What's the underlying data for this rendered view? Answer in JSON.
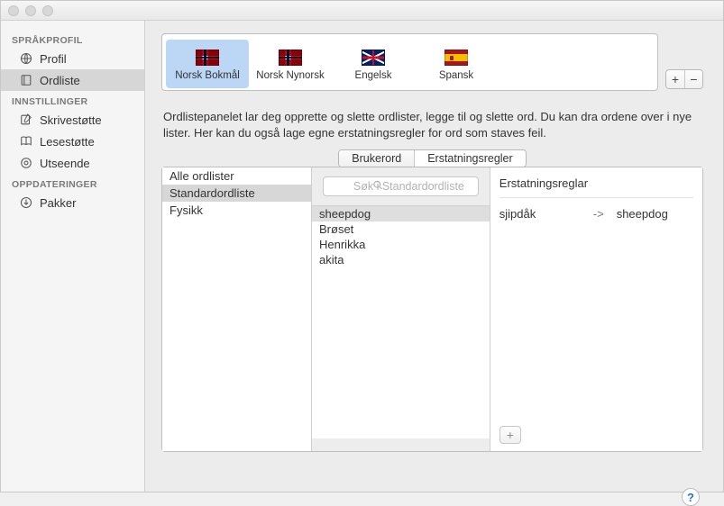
{
  "sidebar": {
    "groups": [
      {
        "title": "SPRÅKPROFIL",
        "items": [
          {
            "label": "Profil"
          },
          {
            "label": "Ordliste"
          }
        ]
      },
      {
        "title": "INNSTILLINGER",
        "items": [
          {
            "label": "Skrivestøtte"
          },
          {
            "label": "Lesestøtte"
          },
          {
            "label": "Utseende"
          }
        ]
      },
      {
        "title": "OPPDATERINGER",
        "items": [
          {
            "label": "Pakker"
          }
        ]
      }
    ]
  },
  "languages": [
    {
      "label": "Norsk Bokmål"
    },
    {
      "label": "Norsk Nynorsk"
    },
    {
      "label": "Engelsk"
    },
    {
      "label": "Spansk"
    }
  ],
  "description": "Ordlistepanelet lar deg opprette og slette ordlister, legge til og slette ord. Du kan dra ordene over i nye lister. Her kan du også lage egne erstatningsregler for ord som staves feil.",
  "tabs": {
    "user_words": "Brukerord",
    "rules": "Erstatningsregler"
  },
  "wordlists": [
    {
      "label": "Alle ordlister"
    },
    {
      "label": "Standardordliste"
    },
    {
      "label": "Fysikk"
    }
  ],
  "search": {
    "placeholder": "Søk i Standardordliste"
  },
  "words": [
    {
      "label": "sheepdog"
    },
    {
      "label": "Brøset"
    },
    {
      "label": "Henrikka"
    },
    {
      "label": "akita"
    }
  ],
  "rules_panel": {
    "title": "Erstatningsreglar",
    "rules": [
      {
        "from": "sjipdåk",
        "arrow": "->",
        "to": "sheepdog"
      }
    ]
  },
  "buttons": {
    "plus": "+",
    "minus": "−",
    "help": "?"
  }
}
